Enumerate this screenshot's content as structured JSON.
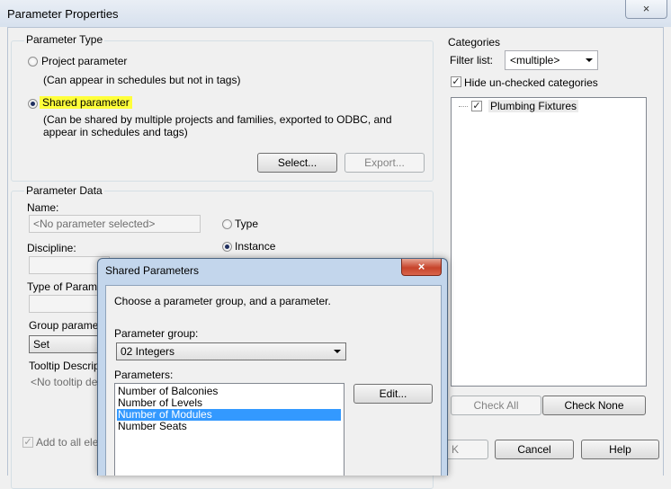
{
  "window": {
    "title": "Parameter Properties",
    "close_glyph": "×"
  },
  "parameter_type": {
    "legend": "Parameter Type",
    "project_label": "Project parameter",
    "project_desc": "(Can appear in schedules but not in tags)",
    "shared_label": "Shared parameter",
    "shared_desc_1": "(Can be shared by multiple projects and families, exported to ODBC, and",
    "shared_desc_2": "appear in schedules and tags)",
    "selected": "shared",
    "select_button": "Select...",
    "export_button": "Export..."
  },
  "parameter_data": {
    "legend": "Parameter Data",
    "name_label": "Name:",
    "name_value": "<No parameter selected>",
    "type_label": "Type",
    "instance_label": "Instance",
    "instance_selected": true,
    "discipline_label": "Discipline:",
    "type_of_parameter_label": "Type of Paramet",
    "group_parameter_label": "Group paramete",
    "group_value": "Set",
    "tooltip_label": "Tooltip Descripti",
    "tooltip_value": "<No tooltip desc",
    "add_to_all_label": "Add to all elem"
  },
  "categories": {
    "legend": "Categories",
    "filter_label": "Filter list:",
    "filter_value": "<multiple>",
    "hide_unchecked_label": "Hide un-checked categories",
    "hide_unchecked": true,
    "items": [
      {
        "label": "Plumbing Fixtures",
        "checked": true
      }
    ],
    "check_all_button": "Check All",
    "check_none_button": "Check None"
  },
  "footer": {
    "ok_fragment": "K",
    "cancel_button": "Cancel",
    "help_button": "Help"
  },
  "shared_dialog": {
    "title": "Shared Parameters",
    "close_glyph": "×",
    "instruction": "Choose a parameter group, and a parameter.",
    "group_label": "Parameter group:",
    "group_value": "02 Integers",
    "parameters_label": "Parameters:",
    "parameters": [
      "Number of Balconies",
      "Number of Levels",
      "Number of Modules",
      "Number Seats"
    ],
    "selected_index": 2,
    "edit_button": "Edit..."
  },
  "colors": {
    "highlight": "#ffff3a",
    "selection": "#3399ff",
    "dialog_frame": "#c3d6ec"
  }
}
